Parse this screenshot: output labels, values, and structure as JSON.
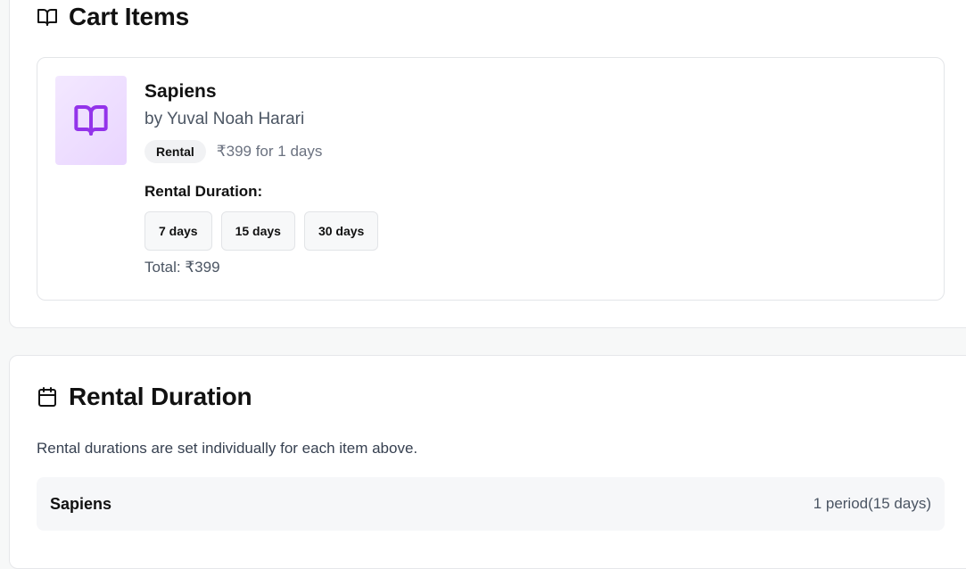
{
  "cart": {
    "title": "Cart Items",
    "title_icon": "book-open-icon",
    "item": {
      "cover_icon": "book-open-icon",
      "cover_color": "#9333ea",
      "title": "Sapiens",
      "author": "by Yuval Noah Harari",
      "badge": "Rental",
      "price": "₹399 for 1 days",
      "duration_label": "Rental Duration:",
      "duration_options": [
        "7 days",
        "15 days",
        "30 days"
      ],
      "total": "Total: ₹399"
    }
  },
  "rental": {
    "title": "Rental Duration",
    "title_icon": "calendar-icon",
    "description": "Rental durations are set individually for each item above.",
    "summary": {
      "name": "Sapiens",
      "meta": "1 period(15 days)"
    }
  }
}
